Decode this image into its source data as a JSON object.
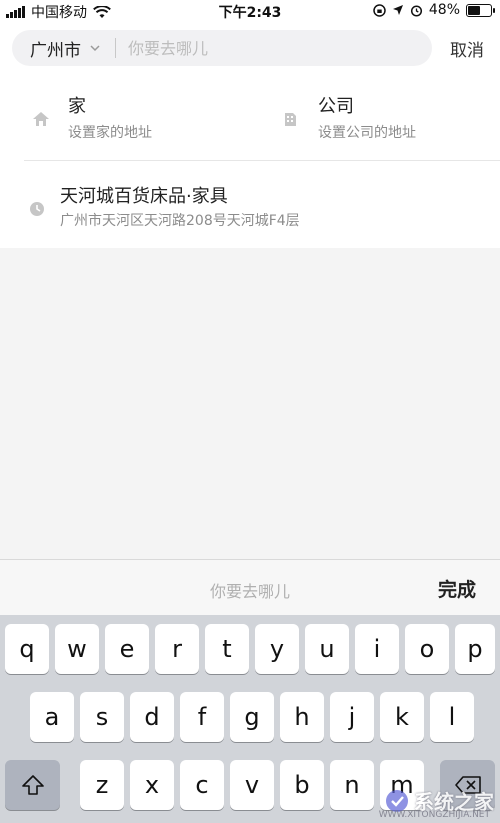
{
  "status_bar": {
    "carrier": "中国移动",
    "time": "下午2:43",
    "battery": "48%",
    "battery_level": 0.48,
    "signal_icon": "signal-bars-icon",
    "wifi_icon": "wifi-icon"
  },
  "search": {
    "city": "广州市",
    "placeholder": "你要去哪儿",
    "value": "",
    "cancel_label": "取消"
  },
  "shortcuts": [
    {
      "title": "家",
      "subtitle": "设置家的地址",
      "icon": "home-icon"
    },
    {
      "title": "公司",
      "subtitle": "设置公司的地址",
      "icon": "building-icon"
    }
  ],
  "history": [
    {
      "title": "天河城百货床品·家具",
      "subtitle": "广州市天河区天河路208号天河城F4层",
      "icon": "clock-icon"
    }
  ],
  "keyboard_toolbar": {
    "hint": "你要去哪儿",
    "done_label": "完成"
  },
  "keyboard": {
    "row1": [
      "q",
      "w",
      "e",
      "r",
      "t",
      "y",
      "u",
      "i",
      "o",
      "p"
    ],
    "row2": [
      "a",
      "s",
      "d",
      "f",
      "g",
      "h",
      "j",
      "k",
      "l"
    ],
    "row3": [
      "z",
      "x",
      "c",
      "v",
      "b",
      "n",
      "m"
    ]
  },
  "watermark": {
    "text": "系统之家",
    "url": "WWW.XITONGZHIJIA.NET"
  },
  "colors": {
    "background": "#f4f4f4",
    "keyboard_background": "#d1d4d9",
    "special_key": "#aeb3be",
    "secondary_text": "#8c8c8c",
    "placeholder_text": "#bdbdbd"
  }
}
